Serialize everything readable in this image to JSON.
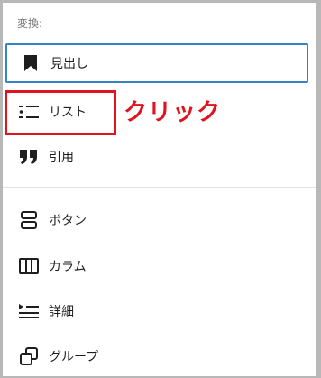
{
  "menu": {
    "heading": "変換:",
    "items": [
      {
        "label": "見出し",
        "icon": "bookmark-icon",
        "selected": true
      },
      {
        "label": "リスト",
        "icon": "list-icon",
        "selected": false
      },
      {
        "label": "引用",
        "icon": "quote-icon",
        "selected": false
      },
      {
        "label": "ボタン",
        "icon": "buttons-icon",
        "selected": false
      },
      {
        "label": "カラム",
        "icon": "columns-icon",
        "selected": false
      },
      {
        "label": "詳細",
        "icon": "details-icon",
        "selected": false
      },
      {
        "label": "グループ",
        "icon": "group-icon",
        "selected": false
      }
    ]
  },
  "annotation": {
    "text": "クリック",
    "color": "#e0141e"
  },
  "colors": {
    "selected_border": "#3582c4",
    "text": "#1e1e1e",
    "heading": "#757575"
  }
}
